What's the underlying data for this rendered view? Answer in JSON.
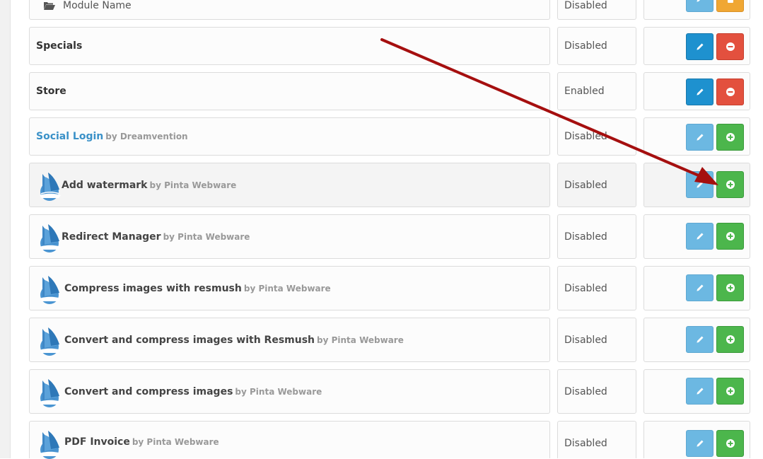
{
  "header": {
    "module_column": "Module Name",
    "status": "Disabled"
  },
  "rows": [
    {
      "name": "Specials",
      "status": "Disabled"
    },
    {
      "name": "Store",
      "status": "Enabled"
    },
    {
      "name": "Social Login",
      "by": "by Dreamvention",
      "status": "Disabled"
    },
    {
      "name": "Add watermark",
      "by": "by Pinta Webware",
      "status": "Disabled"
    },
    {
      "name": "Redirect Manager",
      "by": "by Pinta Webware",
      "status": "Disabled"
    },
    {
      "name": "Compress images with resmush",
      "by": "by Pinta Webware",
      "status": "Disabled"
    },
    {
      "name": "Convert and compress images with Resmush",
      "by": "by Pinta Webware",
      "status": "Disabled"
    },
    {
      "name": "Convert and compress images",
      "by": "by Pinta Webware",
      "status": "Disabled"
    },
    {
      "name": "PDF Invoice",
      "by": "by Pinta Webware",
      "status": "Disabled"
    }
  ],
  "icons": {
    "edit": "pencil-icon",
    "uninstall": "minus-circle-icon",
    "install": "plus-circle-icon",
    "logo": "ship-logo-icon",
    "folder": "folder-open-icon",
    "delete": "trash-icon"
  },
  "colors": {
    "edit_blue": "#1e91cf",
    "edit_light": "#6cb8e2",
    "uninstall_red": "#e3503e",
    "install_green": "#4cb64c",
    "delete_orange": "#f0a733",
    "annotation_arrow": "#a50f0f",
    "link_blue": "#3a91c8"
  }
}
